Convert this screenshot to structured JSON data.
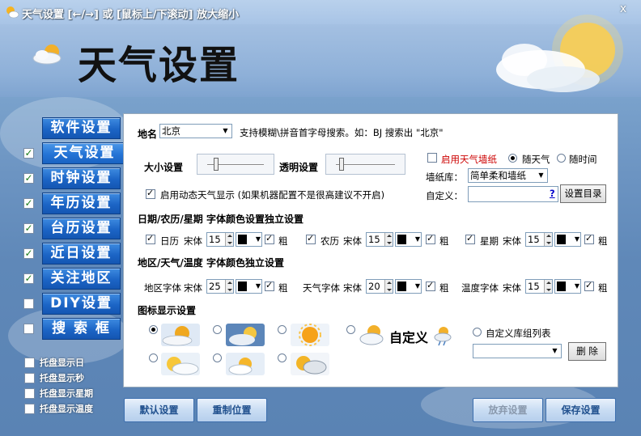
{
  "window": {
    "title": "天气设置 [←/→] 或 [鼠标上/下滚动] 放大缩小",
    "close_label": "x"
  },
  "header": {
    "title": "天气设置"
  },
  "nav": {
    "tabs": [
      {
        "label": "软件设置",
        "checked": null
      },
      {
        "label": "天气设置",
        "checked": true,
        "active": true
      },
      {
        "label": "时钟设置",
        "checked": true
      },
      {
        "label": "年历设置",
        "checked": true
      },
      {
        "label": "台历设置",
        "checked": true
      },
      {
        "label": "近日设置",
        "checked": true
      },
      {
        "label": "关注地区",
        "checked": true
      },
      {
        "label": "DIY设置",
        "checked": false
      },
      {
        "label": "搜 索 框",
        "checked": false
      }
    ],
    "tray": [
      {
        "label": "托盘显示日",
        "checked": false
      },
      {
        "label": "托盘显示秒",
        "checked": false
      },
      {
        "label": "托盘显示星期",
        "checked": false
      },
      {
        "label": "托盘显示温度",
        "checked": false
      }
    ]
  },
  "panel": {
    "location_label": "地名",
    "location_value": "北京",
    "location_hint": "支持模糊\\拼音首字母搜索。如：BJ 搜索出 \"北京\"",
    "size_label": "大小设置",
    "size_level": 0.1,
    "opacity_label": "透明设置",
    "opacity_level": 0.05,
    "dynamic_weather_label": "启用动态天气显示 (如果机器配置不是很高建议不开启)",
    "dynamic_weather_checked": true,
    "wallpaper_enable_label": "启用天气墙纸",
    "wallpaper_enable_checked": false,
    "radio_follow_weather": "随天气",
    "radio_follow_time": "随时间",
    "wallpaper_lib_label": "墙纸库：",
    "wallpaper_lib_value": "简单柔和墙纸",
    "custom_label": "自定义：",
    "custom_value": "",
    "help_label": "?",
    "set_dir_button": "设置目录",
    "date_section_title": "日期/农历/星期 字体颜色设置独立设置",
    "date_fonts": [
      {
        "label": "日历",
        "font": "宋体",
        "size": "15",
        "bold_label": "粗",
        "checked": true,
        "bold": true
      },
      {
        "label": "农历",
        "font": "宋体",
        "size": "15",
        "bold_label": "粗",
        "checked": true,
        "bold": true
      },
      {
        "label": "星期",
        "font": "宋体",
        "size": "15",
        "bold_label": "粗",
        "checked": true,
        "bold": true
      }
    ],
    "region_section_title": "地区/天气/温度 字体颜色独立设置",
    "region_fonts": [
      {
        "label": "地区字体",
        "font": "宋体",
        "size": "25",
        "bold_label": "粗",
        "bold": true
      },
      {
        "label": "天气字体",
        "font": "宋体",
        "size": "20",
        "bold_label": "粗",
        "bold": true
      },
      {
        "label": "温度字体",
        "font": "宋体",
        "size": "15",
        "bold_label": "粗",
        "bold": true
      }
    ],
    "icon_section_title": "图标显示设置",
    "custom_icon_label": "自定义",
    "custom_lib_label": "自定义库组列表",
    "delete_button": "删 除"
  },
  "footer": {
    "default_button": "默认设置",
    "reset_position_button": "重制位置",
    "discard_button": "放弃设置",
    "save_button": "保存设置"
  },
  "colors": {
    "accent_tab": "#1c65c6",
    "wallpaper_enable_text": "#cc0000",
    "help_link": "#0000cc"
  }
}
